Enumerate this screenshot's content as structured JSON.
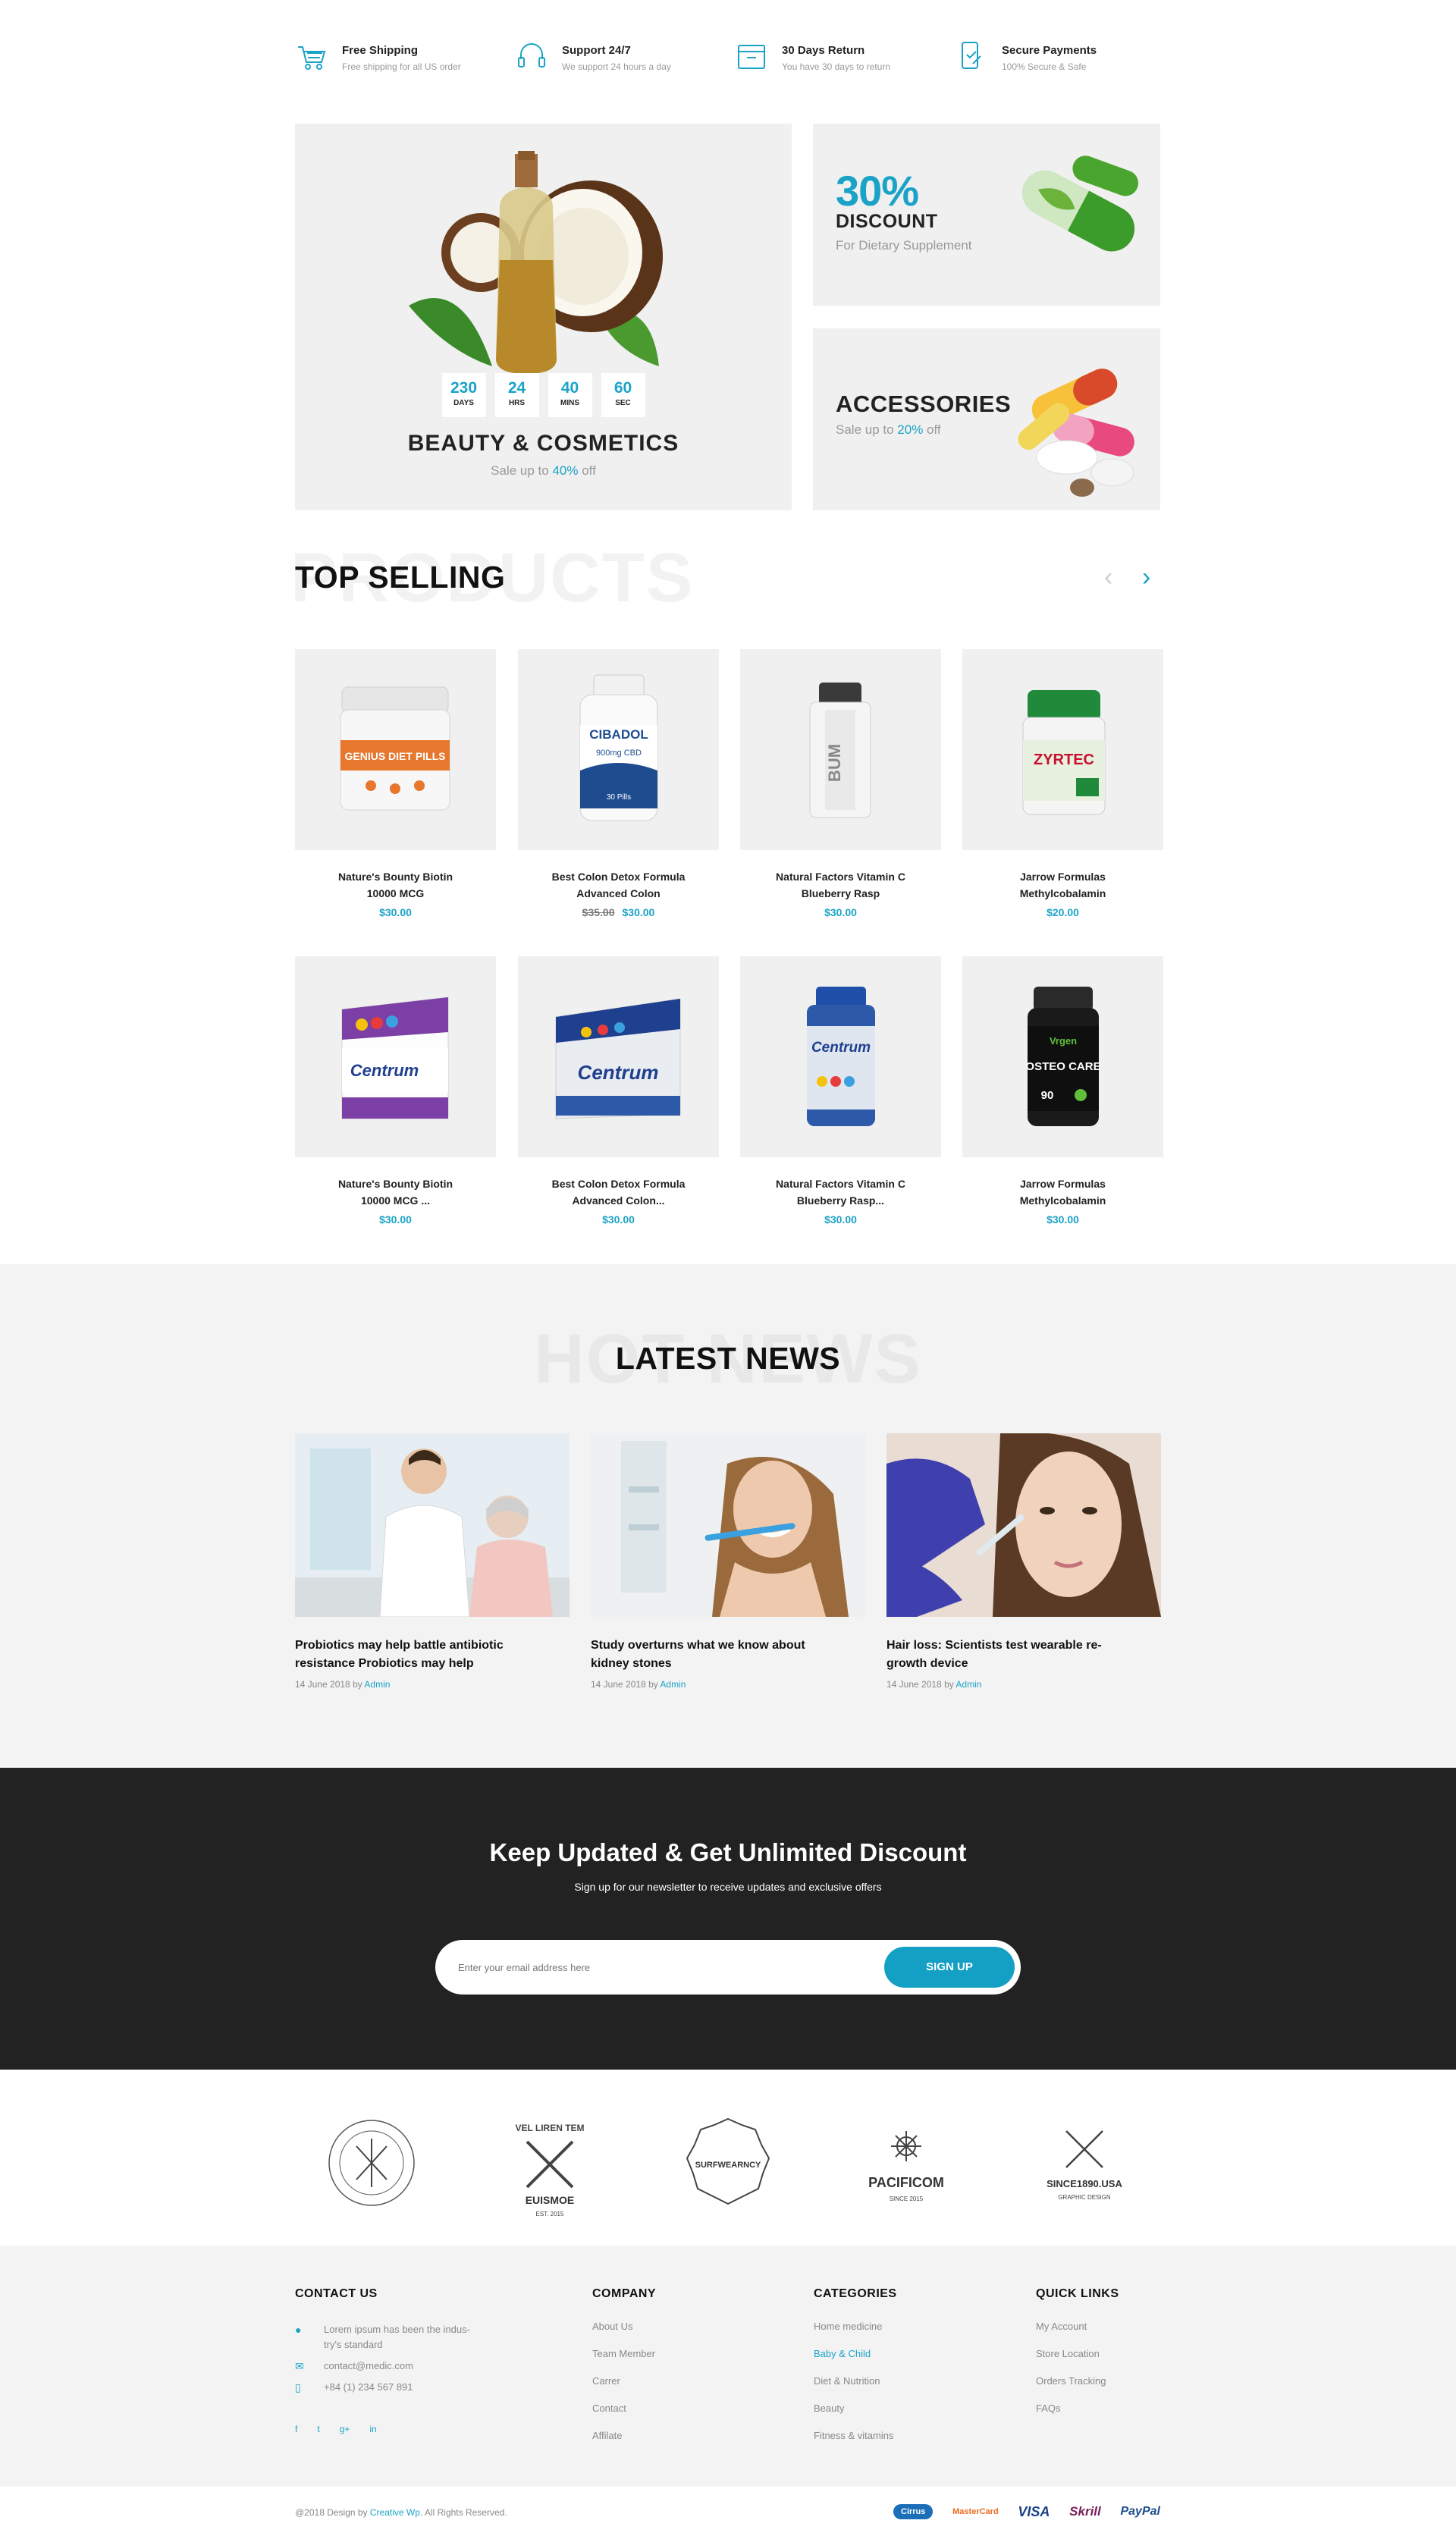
{
  "features": [
    {
      "icon": "cart-icon",
      "title": "Free Shipping",
      "sub": "Free shipping for all US order"
    },
    {
      "icon": "headset-icon",
      "title": "Support 24/7",
      "sub": "We support 24 hours a day"
    },
    {
      "icon": "return-box-icon",
      "title": "30 Days Return",
      "sub": "You have 30 days to return"
    },
    {
      "icon": "secure-payment-icon",
      "title": "Secure Payments",
      "sub": "100% Secure & Safe"
    }
  ],
  "banner_main": {
    "countdown": [
      {
        "value": "230",
        "label": "DAYS"
      },
      {
        "value": "24",
        "label": "HRS"
      },
      {
        "value": "40",
        "label": "MINS"
      },
      {
        "value": "60",
        "label": "SEC"
      }
    ],
    "title": "BEAUTY & COSMETICS",
    "sub_prefix": "Sale up to ",
    "sub_pct": "40%",
    "sub_suffix": " off"
  },
  "banner_discount": {
    "pct": "30%",
    "label": "DISCOUNT",
    "sub": "For Dietary Supplement"
  },
  "banner_accessories": {
    "title": "ACCESSORIES",
    "sub_prefix": "Sale up to ",
    "sub_pct": "20%",
    "sub_suffix": " off"
  },
  "top_selling": {
    "ghost": "PRODUCTS",
    "title": "TOP SELLING",
    "prev": "‹",
    "next": "›",
    "products": [
      {
        "name1": "Nature's Bounty Biotin",
        "name2": "10000 MCG",
        "price": "$30.00",
        "old": ""
      },
      {
        "name1": "Best Colon Detox Formula",
        "name2": "Advanced Colon",
        "price": "$30.00",
        "old": "$35.00"
      },
      {
        "name1": "Natural Factors Vitamin C",
        "name2": "Blueberry Rasp",
        "price": "$30.00",
        "old": ""
      },
      {
        "name1": "Jarrow Formulas",
        "name2": "Methylcobalamin",
        "price": "$20.00",
        "old": ""
      },
      {
        "name1": "Nature's Bounty Biotin",
        "name2": "10000 MCG ...",
        "price": "$30.00",
        "old": ""
      },
      {
        "name1": "Best Colon Detox Formula",
        "name2": "Advanced Colon...",
        "price": "$30.00",
        "old": ""
      },
      {
        "name1": "Natural Factors Vitamin C",
        "name2": "Blueberry Rasp...",
        "price": "$30.00",
        "old": ""
      },
      {
        "name1": "Jarrow Formulas",
        "name2": "Methylcobalamin",
        "price": "$30.00",
        "old": ""
      }
    ],
    "labels": {
      "p1": "GENIUS DIET PILLS",
      "p2a": "CIBADOL",
      "p2b": "900mg CBD",
      "p2c": "30 Pills",
      "p3": "BUM",
      "p4": "ZYRTEC",
      "p5": "Centrum",
      "p6": "Centrum",
      "p7": "Centrum",
      "p8a": "Vrgen",
      "p8b": "OSTEO CARE",
      "p8c": "90"
    }
  },
  "news": {
    "ghost": "HOT NEWS",
    "title": "LATEST NEWS",
    "items": [
      {
        "title1": "Probiotics may help battle antibiotic",
        "title2": "resistance Probiotics may help",
        "date": "14 June 2018 by ",
        "author": "Admin"
      },
      {
        "title1": "Study overturns what we know about",
        "title2": "kidney stones",
        "date": "14 June 2018 by ",
        "author": "Admin"
      },
      {
        "title1": "Hair loss: Scientists test wearable re-",
        "title2": "growth device",
        "date": "14 June 2018 by ",
        "author": "Admin"
      }
    ]
  },
  "newsletter": {
    "title": "Keep Updated & Get Unlimited Discount",
    "sub": "Sign up for our newsletter to receive updates and exclusive offers",
    "placeholder": "Enter your email address here",
    "button": "SIGN UP"
  },
  "brands": [
    {
      "name": "",
      "icon": "arrows-badge-icon"
    },
    {
      "name": "EUISMOE",
      "icon": "axes-badge-icon"
    },
    {
      "name": "SURFWEARNCY",
      "icon": "seal-badge-icon"
    },
    {
      "name": "PACIFICOM",
      "icon": "wheel-badge-icon"
    },
    {
      "name": "SINCE1890.USA",
      "icon": "crossed-arrows-badge-icon"
    }
  ],
  "brand_text": {
    "b2_top": "VEL LIREN TEM",
    "b2_bottom": "EST. 2015",
    "b4_bottom": "SINCE 2015",
    "b5_bottom": "GRAPHIC DESIGN"
  },
  "footer": {
    "contact": {
      "title": "CONTACT US",
      "address1": "Lorem ipsum has been the indus-",
      "address2": "try's standard",
      "email": "contact@medic.com",
      "phone": "+84 (1) 234 567 891",
      "social": [
        "f",
        "t",
        "g+",
        "in"
      ]
    },
    "company": {
      "title": "COMPANY",
      "links": [
        "About Us",
        "Team Member",
        "Carrer",
        "Contact",
        "Affilate"
      ]
    },
    "categories": {
      "title": "CATEGORIES",
      "links": [
        "Home medicine",
        "Baby & Child",
        "Diet & Nutrition",
        "Beauty",
        "Fitness & vitamins"
      ]
    },
    "quick": {
      "title": "QUICK LINKS",
      "links": [
        "My Account",
        "Store Location",
        "Orders Tracking",
        "FAQs"
      ]
    },
    "copyright_prefix": "@2018 Design by ",
    "copyright_brand": "Creative Wp",
    "copyright_suffix": ". All Rights Reserved.",
    "payments": [
      "Cirrus",
      "MasterCard",
      "VISA",
      "Skrill",
      "PayPal"
    ]
  },
  "colors": {
    "accent": "#1aa3c7",
    "dark": "#222222",
    "panel": "#f0f0f0"
  }
}
